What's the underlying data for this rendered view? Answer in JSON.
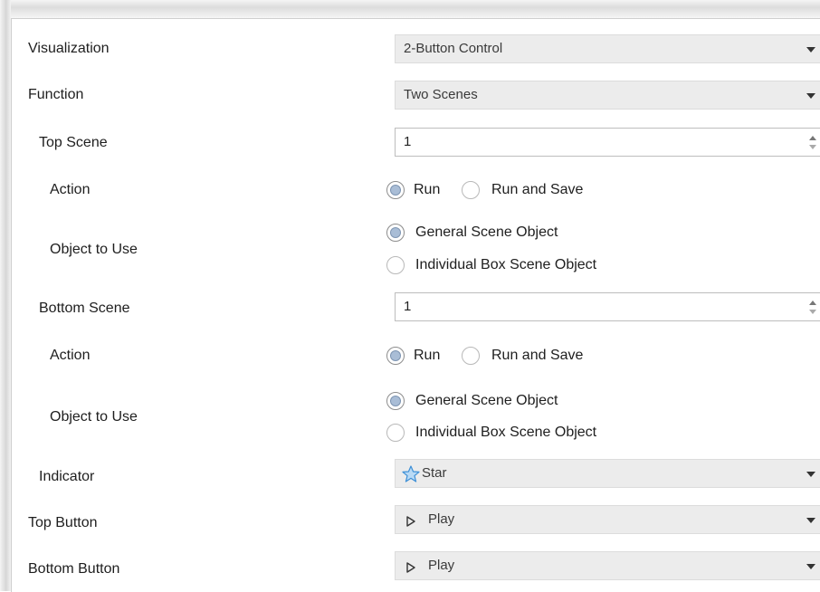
{
  "rows": {
    "visualization": {
      "label": "Visualization",
      "value": "2-Button Control"
    },
    "function": {
      "label": "Function",
      "value": "Two Scenes"
    },
    "top_scene": {
      "label": "Top Scene",
      "value": "1",
      "action": {
        "label": "Action",
        "options": [
          "Run",
          "Run and Save"
        ],
        "selected": "Run"
      },
      "object": {
        "label": "Object to Use",
        "options": [
          "General Scene Object",
          "Individual Box Scene Object"
        ],
        "selected": "General Scene Object"
      }
    },
    "bottom_scene": {
      "label": "Bottom Scene",
      "value": "1",
      "action": {
        "label": "Action",
        "options": [
          "Run",
          "Run and Save"
        ],
        "selected": "Run"
      },
      "object": {
        "label": "Object to Use",
        "options": [
          "General Scene Object",
          "Individual Box Scene Object"
        ],
        "selected": "General Scene Object"
      }
    },
    "indicator": {
      "label": "Indicator",
      "value": "Star",
      "icon": "star-icon"
    },
    "top_button": {
      "label": "Top Button",
      "value": "Play",
      "icon": "play-icon"
    },
    "bottom_button": {
      "label": "Bottom Button",
      "value": "Play",
      "icon": "play-icon"
    }
  }
}
